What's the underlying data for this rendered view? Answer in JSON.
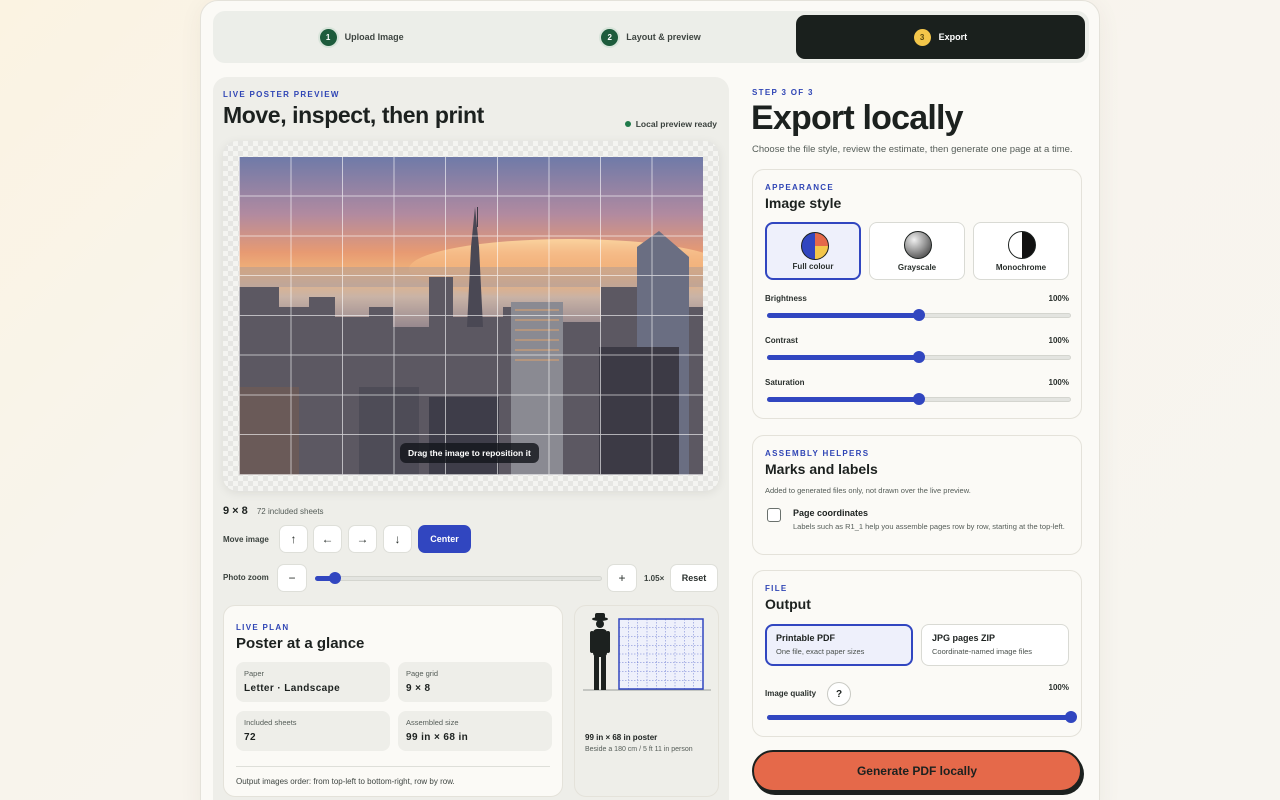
{
  "stepper": {
    "steps": [
      {
        "num": "1",
        "label": "Upload Image"
      },
      {
        "num": "2",
        "label": "Layout & preview"
      },
      {
        "num": "3",
        "label": "Export"
      }
    ],
    "active_index": 2
  },
  "preview": {
    "eyebrow": "LIVE POSTER PREVIEW",
    "title": "Move, inspect, then print",
    "status": "Local preview ready",
    "drag_hint": "Drag the image to reposition it",
    "grid_label": "9 × 8",
    "sheets_label": "72 included sheets",
    "move_label": "Move image",
    "move_buttons": {
      "up": "↑",
      "left": "←",
      "right": "→",
      "down": "↓",
      "center": "Center"
    },
    "zoom_label": "Photo zoom",
    "zoom_minus": "−",
    "zoom_plus": "+",
    "zoom_value_text": "1.05×",
    "zoom_fraction": 0.07,
    "reset": "Reset"
  },
  "plan": {
    "eyebrow": "LIVE PLAN",
    "title": "Poster at a glance",
    "stats": [
      {
        "key": "Paper",
        "value": "Letter · Landscape"
      },
      {
        "key": "Page grid",
        "value": "9 × 8"
      },
      {
        "key": "Included sheets",
        "value": "72"
      },
      {
        "key": "Assembled size",
        "value": "99 in × 68 in"
      }
    ],
    "note": "Output images order: from top-left to bottom-right, row by row."
  },
  "scale": {
    "caption": "99 in × 68 in poster",
    "sub": "Beside a 180 cm / 5 ft 11 in person"
  },
  "export": {
    "eyebrow": "STEP 3 OF 3",
    "title": "Export locally",
    "subtitle": "Choose the file style, review the estimate, then generate one page at a time."
  },
  "appearance": {
    "eyebrow": "APPEARANCE",
    "title": "Image style",
    "options": [
      "Full colour",
      "Grayscale",
      "Monochrome"
    ],
    "selected": "Full colour",
    "adjustments": [
      {
        "label": "Brightness",
        "value": "100%",
        "fraction": 0.5
      },
      {
        "label": "Contrast",
        "value": "100%",
        "fraction": 0.5
      },
      {
        "label": "Saturation",
        "value": "100%",
        "fraction": 0.5
      }
    ]
  },
  "helpers": {
    "eyebrow": "ASSEMBLY HELPERS",
    "title": "Marks and labels",
    "description": "Added to generated files only, not drawn over the live preview.",
    "coords_title": "Page coordinates",
    "coords_desc": "Labels such as R1_1 help you assemble pages row by row, starting at the top-left.",
    "coords_checked": false
  },
  "file": {
    "eyebrow": "FILE",
    "title": "Output",
    "options": [
      {
        "title": "Printable PDF",
        "desc": "One file, exact paper sizes"
      },
      {
        "title": "JPG pages ZIP",
        "desc": "Coordinate-named image files"
      }
    ],
    "selected": "Printable PDF",
    "quality_label": "Image quality",
    "quality_help": "?",
    "quality_value": "100%",
    "quality_fraction": 1.0
  },
  "generate_label": "Generate PDF locally",
  "colors": {
    "accent": "#3146c0",
    "dark": "#1a201d",
    "cta": "#e5694a",
    "success": "#1f7a4a",
    "step_active_badge": "#f3c64a"
  }
}
